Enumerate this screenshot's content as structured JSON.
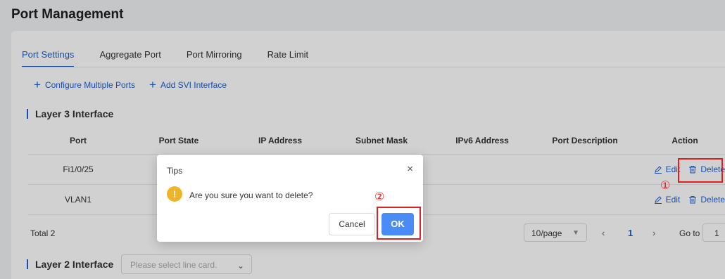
{
  "page": {
    "title": "Port Management"
  },
  "tabs": [
    {
      "label": "Port Settings"
    },
    {
      "label": "Aggregate Port"
    },
    {
      "label": "Port Mirroring"
    },
    {
      "label": "Rate Limit"
    }
  ],
  "toolbar": {
    "configure_multiple": "Configure Multiple Ports",
    "add_svi": "Add SVI Interface"
  },
  "layer3": {
    "title": "Layer 3 Interface",
    "columns": [
      "Port",
      "Port State",
      "IP Address",
      "Subnet Mask",
      "IPv6 Address",
      "Port Description",
      "Action"
    ],
    "rows": [
      {
        "port": "Fi1/0/25",
        "edit": "Edit",
        "delete": "Delete"
      },
      {
        "port": "VLAN1",
        "edit": "Edit",
        "delete": "Delete"
      }
    ]
  },
  "pagination": {
    "total": "Total 2",
    "page_size": "10/page",
    "prev": "‹",
    "current": "1",
    "next": "›",
    "goto_label": "Go to",
    "goto_value": "1"
  },
  "layer2": {
    "title": "Layer 2 Interface",
    "select_placeholder": "Please select line card."
  },
  "dialog": {
    "title": "Tips",
    "close": "×",
    "message": "Are you sure you want to delete?",
    "cancel": "Cancel",
    "ok": "OK"
  },
  "annotations": {
    "marker1": "①",
    "marker2": "②"
  },
  "colors": {
    "accent": "#1a5fd8",
    "ok_button": "#4a8cf5",
    "highlight": "#e02020",
    "warning": "#f0b429"
  },
  "icons": [
    "plus-icon",
    "edit-icon",
    "trash-icon",
    "warning-icon",
    "close-icon",
    "chevron-down-icon"
  ]
}
